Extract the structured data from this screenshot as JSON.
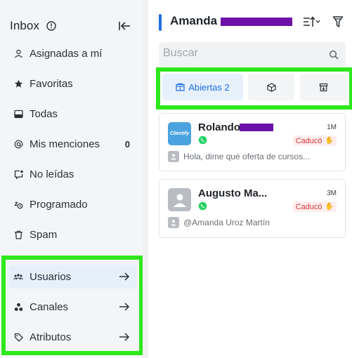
{
  "sidebar": {
    "title": "Inbox",
    "items": [
      {
        "label": "Asignadas a mí",
        "icon": "user-icon"
      },
      {
        "label": "Favoritas",
        "icon": "star-icon"
      },
      {
        "label": "Todas",
        "icon": "inbox-tray-icon"
      },
      {
        "label": "Mis menciones",
        "icon": "at-sign-icon",
        "count": "0"
      },
      {
        "label": "No leídas",
        "icon": "unread-message-icon"
      },
      {
        "label": "Programado",
        "icon": "snooze-icon"
      },
      {
        "label": "Spam",
        "icon": "trash-icon"
      }
    ],
    "sections": [
      {
        "label": "Usuarios",
        "icon": "users-icon"
      },
      {
        "label": "Canales",
        "icon": "channels-icon"
      },
      {
        "label": "Atributos",
        "icon": "tag-icon"
      }
    ]
  },
  "main": {
    "agent_name": "Amanda",
    "search_placeholder": "Buscar",
    "tabs": [
      {
        "label": "Abiertas 2",
        "icon": "open-inbox-icon",
        "active": true
      },
      {
        "label": "",
        "icon": "box-icon",
        "active": false
      },
      {
        "label": "",
        "icon": "archive-icon",
        "active": false
      }
    ],
    "conversations": [
      {
        "name": "Rolando",
        "avatar_text": "Clientify",
        "channel": "whatsapp-icon",
        "time": "1M",
        "status": "Caducó",
        "preview": "Hola, dime qué oferta de cursos..."
      },
      {
        "name": "Augusto Ma...",
        "avatar_text": "",
        "channel": "whatsapp-icon",
        "time": "3M",
        "status": "Caducó",
        "preview": "@Amanda Uroz Martín"
      }
    ]
  },
  "colors": {
    "accent": "#1f6fe5",
    "highlight_outline": "#2ee81c",
    "redaction": "#6c11a7",
    "expired_badge": "#d4373c",
    "whatsapp": "#25d366"
  }
}
